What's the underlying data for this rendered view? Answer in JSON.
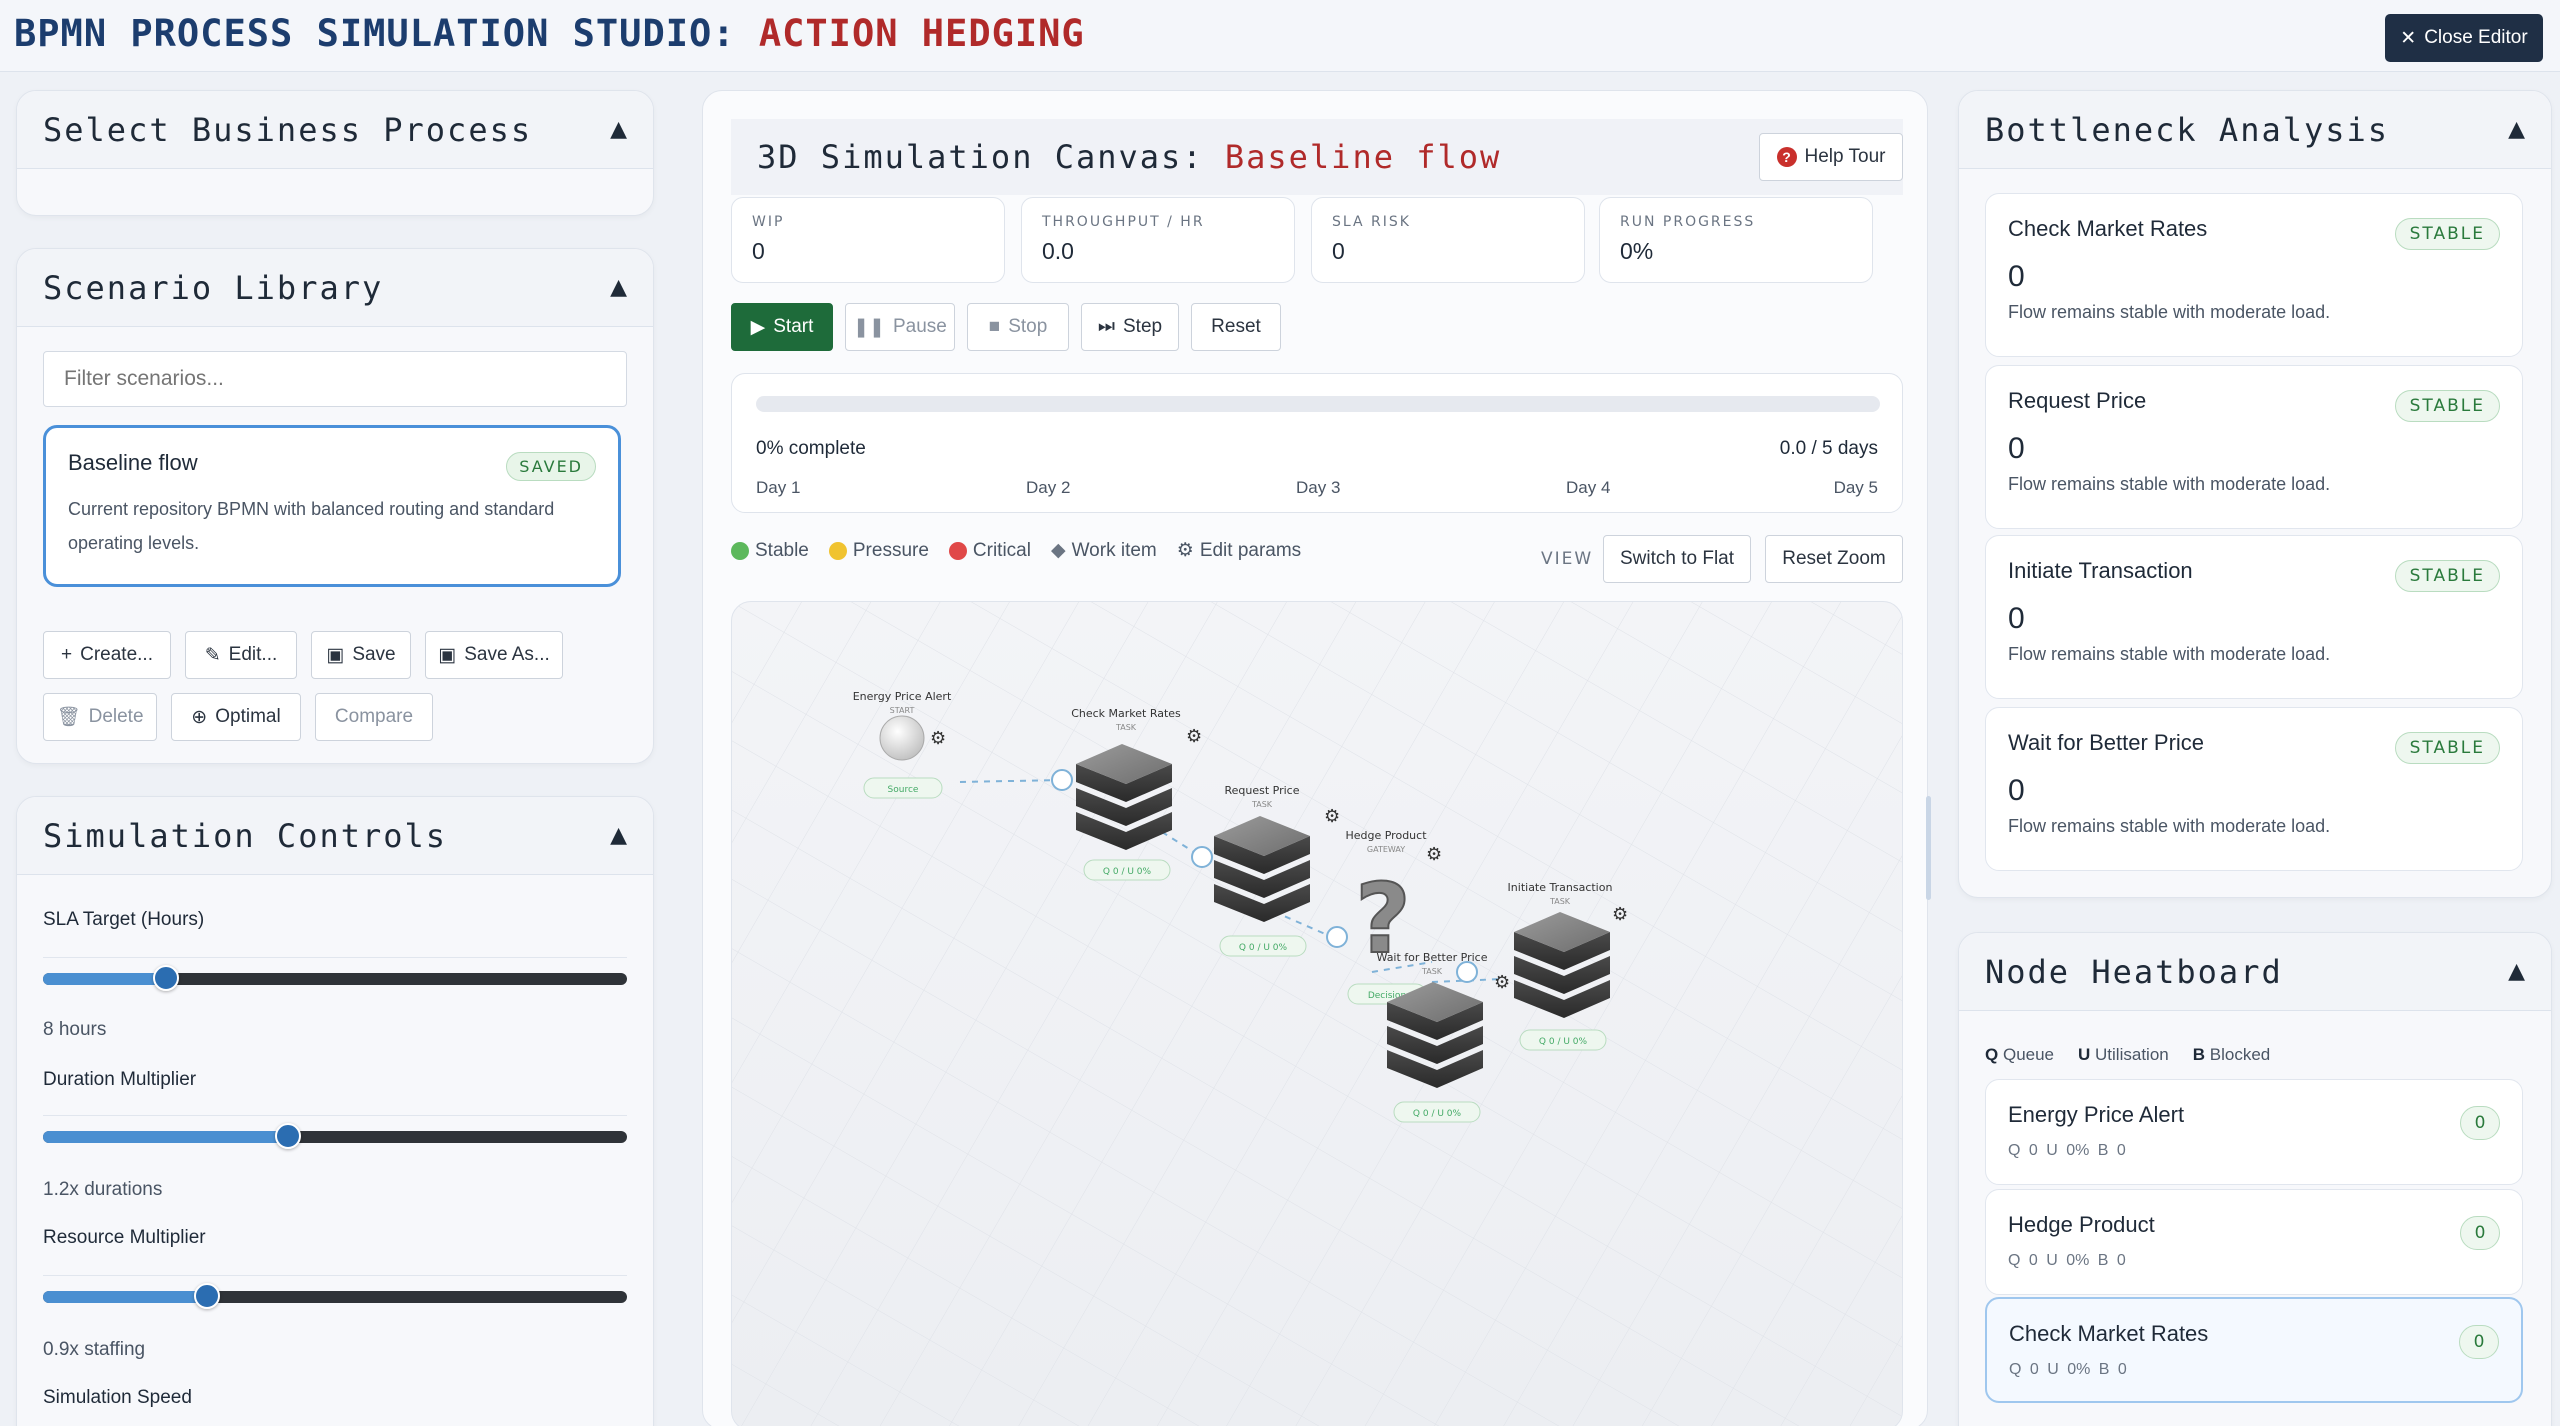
{
  "header": {
    "title_prefix": "BPMN PROCESS SIMULATION STUDIO:",
    "title_accent": "ACTION HEDGING",
    "close_label": "Close Editor"
  },
  "left": {
    "select_process": {
      "title": "Select Business Process"
    },
    "scenario_library": {
      "title": "Scenario Library",
      "filter_placeholder": "Filter scenarios...",
      "scenario": {
        "name": "Baseline flow",
        "badge": "SAVED",
        "description": "Current repository BPMN with balanced routing and standard operating levels."
      },
      "buttons": {
        "create": "Create...",
        "edit": "Edit...",
        "save": "Save",
        "save_as": "Save As...",
        "delete": "Delete",
        "optimal": "Optimal",
        "compare": "Compare"
      }
    },
    "simulation_controls": {
      "title": "Simulation Controls",
      "sliders": [
        {
          "label": "SLA Target (Hours)",
          "value_text": "8 hours",
          "fraction": 0.21
        },
        {
          "label": "Duration Multiplier",
          "value_text": "1.2x durations",
          "fraction": 0.42
        },
        {
          "label": "Resource Multiplier",
          "value_text": "0.9x staffing",
          "fraction": 0.28
        },
        {
          "label": "Simulation Speed"
        }
      ]
    }
  },
  "center": {
    "title_prefix": "3D Simulation Canvas:",
    "title_accent": "Baseline flow",
    "help_label": "Help Tour",
    "metrics": [
      {
        "label": "WIP",
        "value": "0"
      },
      {
        "label": "THROUGHPUT / HR",
        "value": "0.0"
      },
      {
        "label": "SLA RISK",
        "value": "0"
      },
      {
        "label": "RUN PROGRESS",
        "value": "0%"
      }
    ],
    "controls": {
      "start": "Start",
      "pause": "Pause",
      "stop": "Stop",
      "step": "Step",
      "reset": "Reset"
    },
    "progress": {
      "fraction": 0,
      "complete_text": "0% complete",
      "days_text": "0.0 / 5 days",
      "days": [
        "Day 1",
        "Day 2",
        "Day 3",
        "Day 4",
        "Day 5"
      ]
    },
    "legend": {
      "stable": "Stable",
      "pressure": "Pressure",
      "critical": "Critical",
      "work_item": "Work item",
      "edit_params": "Edit params"
    },
    "view": {
      "label": "VIEW",
      "switch": "Switch to Flat",
      "reset_zoom": "Reset Zoom"
    },
    "diagram": {
      "start_node": {
        "name": "Energy Price Alert",
        "type": "START",
        "tag": "Source"
      },
      "tasks": [
        {
          "name": "Check Market Rates",
          "type": "TASK",
          "stats": "Q 0 / U 0%"
        },
        {
          "name": "Request Price",
          "type": "TASK",
          "stats": "Q 0 / U 0%"
        },
        {
          "name": "Wait for Better Price",
          "type": "TASK",
          "stats": "Q 0 / U 0%"
        },
        {
          "name": "Initiate Transaction",
          "type": "TASK",
          "stats": "Q 0 / U 0%"
        }
      ],
      "gateway": {
        "name": "Hedge Product",
        "type": "GATEWAY",
        "tag": "Decision"
      }
    }
  },
  "right": {
    "bottleneck": {
      "title": "Bottleneck Analysis",
      "items": [
        {
          "name": "Check Market Rates",
          "badge": "STABLE",
          "value": "0",
          "desc": "Flow remains stable with moderate load."
        },
        {
          "name": "Request Price",
          "badge": "STABLE",
          "value": "0",
          "desc": "Flow remains stable with moderate load."
        },
        {
          "name": "Initiate Transaction",
          "badge": "STABLE",
          "value": "0",
          "desc": "Flow remains stable with moderate load."
        },
        {
          "name": "Wait for Better Price",
          "badge": "STABLE",
          "value": "0",
          "desc": "Flow remains stable with moderate load."
        }
      ]
    },
    "heatboard": {
      "title": "Node Heatboard",
      "legend": {
        "q_key": "Q",
        "q": "Queue",
        "u_key": "U",
        "u": "Utilisation",
        "b_key": "B",
        "b": "Blocked"
      },
      "items": [
        {
          "name": "Energy Price Alert",
          "badge": "0",
          "stats": "Q 0   U 0%   B 0"
        },
        {
          "name": "Hedge Product",
          "badge": "0",
          "stats": "Q 0   U 0%   B 0"
        },
        {
          "name": "Check Market Rates",
          "badge": "0",
          "stats": "Q 0   U 0%   B 0"
        }
      ]
    }
  },
  "colors": {
    "accent_red": "#b02a2a",
    "title_blue": "#1c3d6e",
    "start_green": "#1e6b3a",
    "stable": "#5cb85c",
    "pressure": "#f0c330",
    "critical": "#e04848",
    "slider_fill": "#4a8fd1"
  }
}
